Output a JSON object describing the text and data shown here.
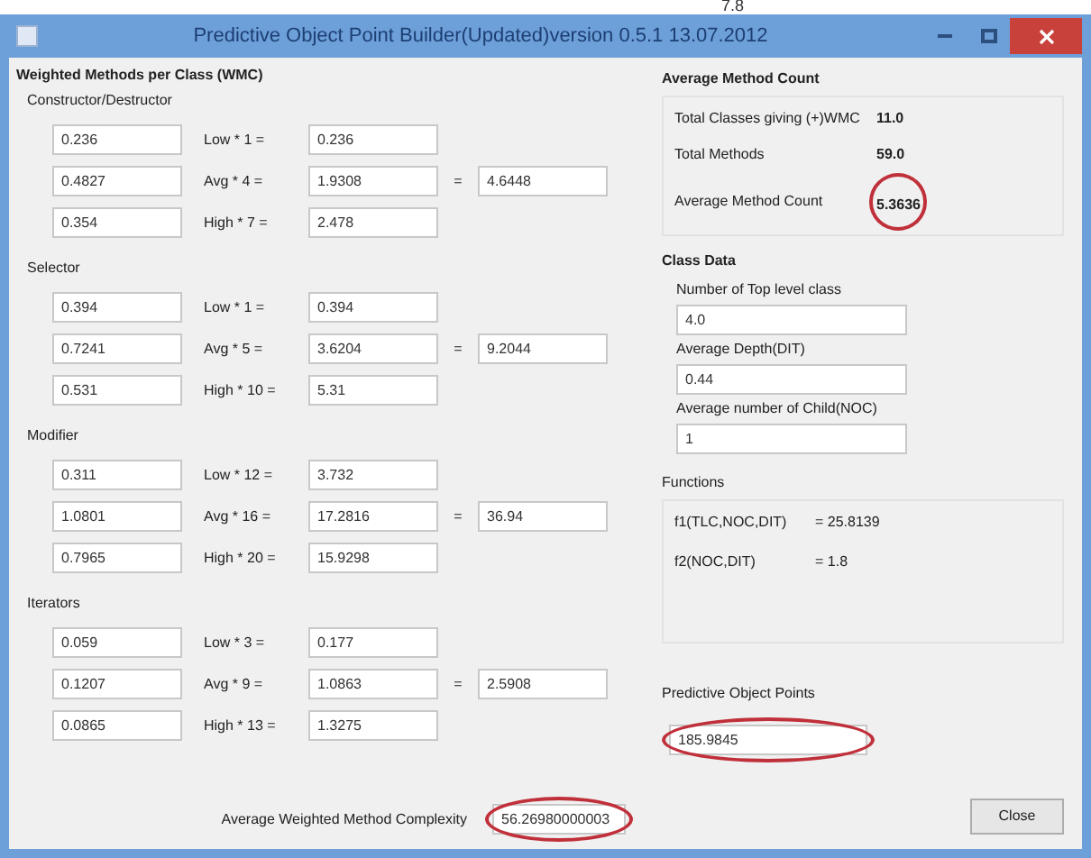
{
  "caption": "7.8",
  "window": {
    "title": "Predictive Object Point Builder(Updated)version 0.5.1 13.07.2012"
  },
  "wmc": {
    "title": "Weighted Methods per Class (WMC)",
    "groups": [
      {
        "name": "Constructor/Destructor",
        "rows": [
          {
            "input": "0.236",
            "label": "Low * 1 =",
            "product": "0.236"
          },
          {
            "input": "0.4827",
            "label": "Avg * 4 =",
            "product": "1.9308",
            "equals": "=",
            "total": "4.6448"
          },
          {
            "input": "0.354",
            "label": "High * 7 =",
            "product": "2.478"
          }
        ]
      },
      {
        "name": "Selector",
        "rows": [
          {
            "input": "0.394",
            "label": "Low * 1 =",
            "product": "0.394"
          },
          {
            "input": "0.7241",
            "label": "Avg * 5 =",
            "product": "3.6204",
            "equals": "=",
            "total": "9.2044"
          },
          {
            "input": "0.531",
            "label": "High * 10 =",
            "product": "5.31"
          }
        ]
      },
      {
        "name": "Modifier",
        "rows": [
          {
            "input": "0.311",
            "label": "Low * 12 =",
            "product": "3.732"
          },
          {
            "input": "1.0801",
            "label": "Avg * 16 =",
            "product": "17.2816",
            "equals": "=",
            "total": "36.94"
          },
          {
            "input": "0.7965",
            "label": "High * 20 =",
            "product": "15.9298"
          }
        ]
      },
      {
        "name": "Iterators",
        "rows": [
          {
            "input": "0.059",
            "label": "Low * 3 =",
            "product": "0.177"
          },
          {
            "input": "0.1207",
            "label": "Avg * 9 =",
            "product": "1.0863",
            "equals": "=",
            "total": "2.5908"
          },
          {
            "input": "0.0865",
            "label": "High * 13 =",
            "product": "1.3275"
          }
        ]
      }
    ],
    "average_label": "Average Weighted Method Complexity",
    "average_value": "56.26980000003"
  },
  "method_count": {
    "title": "Average Method Count",
    "rows": [
      {
        "label": "Total Classes giving (+)WMC",
        "value": "11.0",
        "circled": false
      },
      {
        "label": "Total Methods",
        "value": "59.0",
        "circled": false
      },
      {
        "label": "Average Method Count",
        "value": "5.3636",
        "circled": true
      }
    ]
  },
  "class_data": {
    "title": "Class Data",
    "fields": [
      {
        "label": "Number of Top level class",
        "value": "4.0"
      },
      {
        "label": "Average Depth(DIT)",
        "value": "0.44"
      },
      {
        "label": "Average number of Child(NOC)",
        "value": "1"
      }
    ]
  },
  "functions": {
    "title": "Functions",
    "rows": [
      {
        "label": "f1(TLC,NOC,DIT)",
        "value": "= 25.8139"
      },
      {
        "label": "f2(NOC,DIT)",
        "value": "= 1.8"
      }
    ]
  },
  "pop": {
    "title": "Predictive Object Points",
    "value": "185.9845"
  },
  "buttons": [
    "Close"
  ]
}
